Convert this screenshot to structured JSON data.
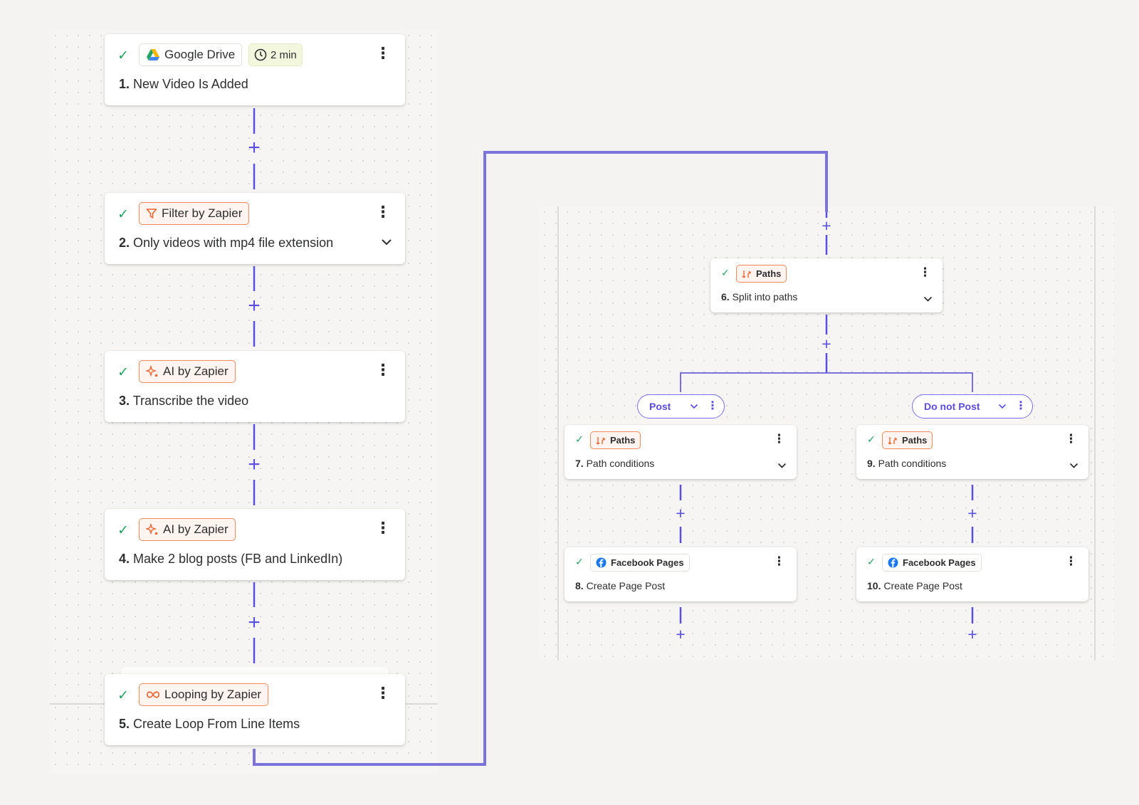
{
  "colors": {
    "accent": "#5b4fe0",
    "loop_line": "#7b73d9",
    "check": "#21a35d",
    "badge_orange": "#f28a5c"
  },
  "steps": [
    {
      "app": "Google Drive",
      "icon": "google-drive-icon",
      "time_badge": "2 min",
      "number": "1.",
      "title": "New Video Is Added"
    },
    {
      "app": "Filter by Zapier",
      "icon": "filter-icon",
      "number": "2.",
      "title": "Only videos with mp4 file extension"
    },
    {
      "app": "AI by Zapier",
      "icon": "ai-sparkle-icon",
      "number": "3.",
      "title": "Transcribe the video"
    },
    {
      "app": "AI by Zapier",
      "icon": "ai-sparkle-icon",
      "number": "4.",
      "title": "Make 2 blog posts (FB and LinkedIn)"
    },
    {
      "app": "Looping by Zapier",
      "icon": "loop-icon",
      "number": "5.",
      "title": "Create Loop From Line Items"
    },
    {
      "app": "Paths",
      "icon": "paths-icon",
      "number": "6.",
      "title": "Split into paths"
    },
    {
      "app": "Paths",
      "icon": "paths-icon",
      "number": "7.",
      "title": "Path conditions"
    },
    {
      "app": "Facebook Pages",
      "icon": "facebook-icon",
      "number": "8.",
      "title": "Create Page Post"
    },
    {
      "app": "Paths",
      "icon": "paths-icon",
      "number": "9.",
      "title": "Path conditions"
    },
    {
      "app": "Facebook Pages",
      "icon": "facebook-icon",
      "number": "10.",
      "title": "Create Page Post"
    }
  ],
  "paths": [
    {
      "label": "Post"
    },
    {
      "label": "Do not Post"
    }
  ],
  "glyphs": {
    "check": "✓",
    "kebab": "⋮",
    "plus": "+"
  }
}
